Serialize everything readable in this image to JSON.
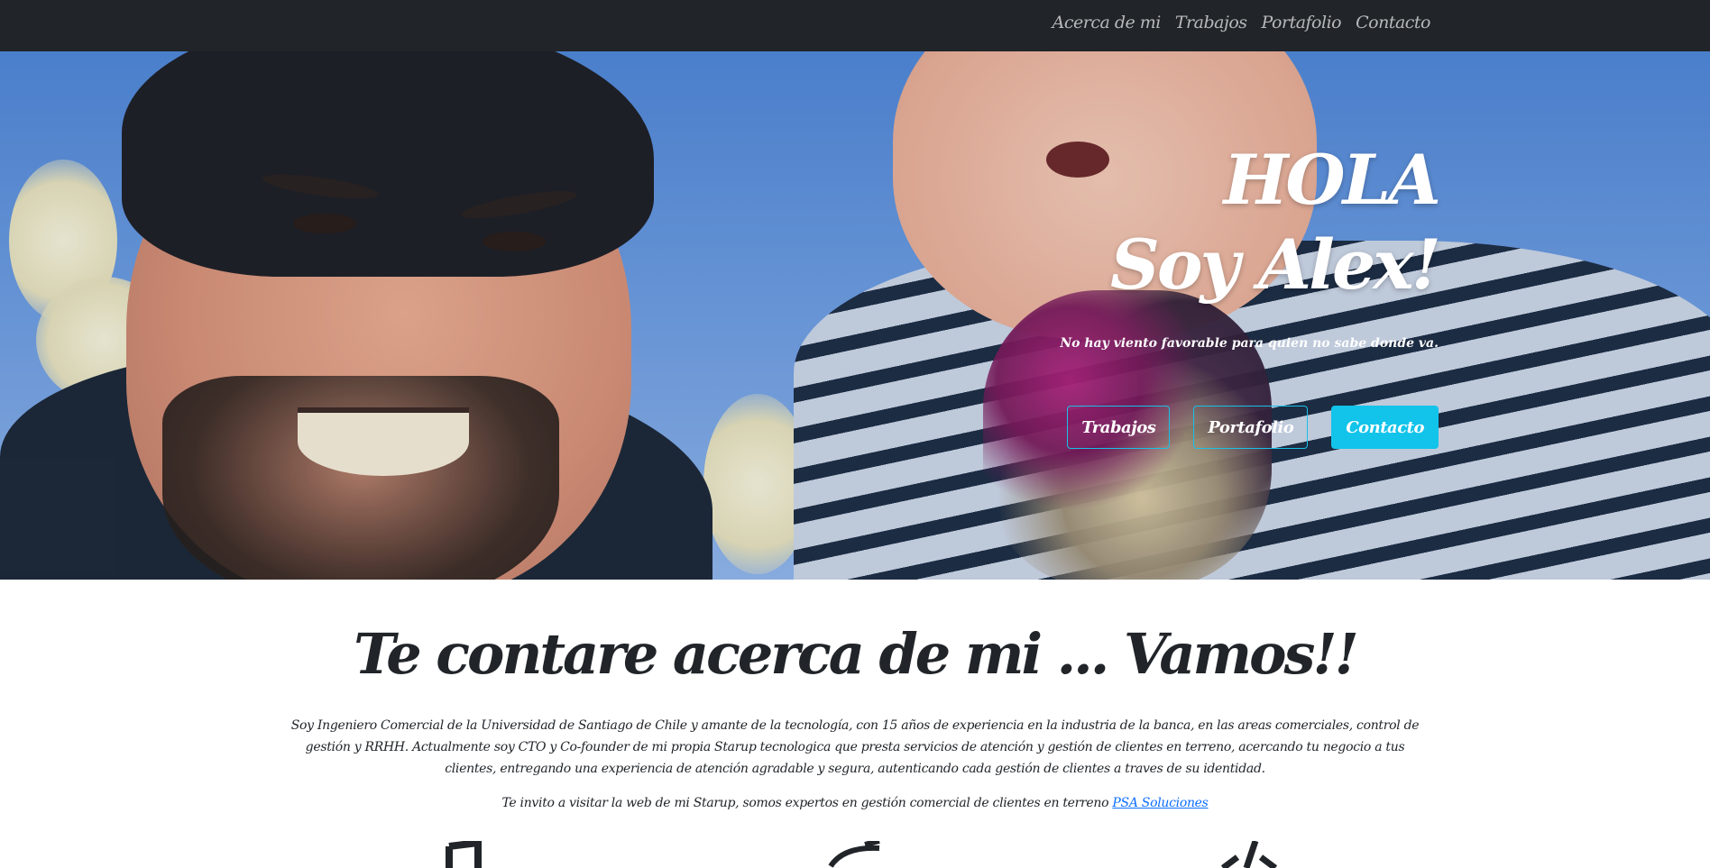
{
  "nav": {
    "links": [
      "Acerca de mi",
      "Trabajos",
      "Portafolio",
      "Contacto"
    ]
  },
  "hero": {
    "title_line1": "HOLA",
    "title_line2": "Soy Alex!",
    "subtitle": "No hay viento favorable para quien no sabe donde va.",
    "buttons": [
      "Trabajos",
      "Portafolio",
      "Contacto"
    ]
  },
  "about": {
    "title": "Te contare acerca de mi ... Vamos!!",
    "paragraph": "Soy Ingeniero Comercial de la Universidad de Santiago de Chile y amante de la tecnología, con 15 años de experiencia en la industria de la banca, en las areas comerciales, control de gestión y RRHH. Actualmente soy CTO y Co-founder de mi propia Starup tecnologica que presta servicios de atención y gestión de clientes en terreno, acercando tu negocio a tus clientes, entregando una experiencia de atención agradable y segura, autenticando cada gestión de clientes a traves de su identidad.",
    "invite_text": "Te invito a visitar la web de mi Starup, somos expertos en gestión comercial de clientes en terreno",
    "invite_link": "PSA Soluciones"
  },
  "colors": {
    "navbar": "#212529",
    "accent": "#12c3ea",
    "link": "#0d6efd"
  },
  "icons": [
    "music-note-icon",
    "pen-icon",
    "code-icon"
  ]
}
